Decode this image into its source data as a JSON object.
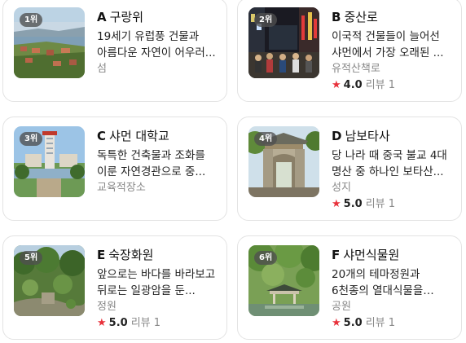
{
  "places": [
    {
      "rank": "1위",
      "letter": "A",
      "name": "구랑위",
      "desc": "19세기 유럽풍 건물과 아름다운 자연이 어우러...",
      "category": "섬"
    },
    {
      "rank": "2위",
      "letter": "B",
      "name": "중산로",
      "desc": "이국적 건물들이 늘어선 샤먼에서 가장 오래된 ...",
      "category": "유적산책로",
      "rating": "4.0",
      "reviews": "리뷰 1"
    },
    {
      "rank": "3위",
      "letter": "C",
      "name": "샤먼 대학교",
      "desc": "독특한 건축물과 조화를 이룬 자연경관으로 중...",
      "category": "교육적장소"
    },
    {
      "rank": "4위",
      "letter": "D",
      "name": "남보타사",
      "desc": "당 나라 때 중국 불교 4대 명산 중 하나인 보타산...",
      "category": "성지",
      "rating": "5.0",
      "reviews": "리뷰 1"
    },
    {
      "rank": "5위",
      "letter": "E",
      "name": "숙장화원",
      "desc": "앞으로는 바다를 바라보고 뒤로는 일광암을 둔...",
      "category": "정원",
      "rating": "5.0",
      "reviews": "리뷰 1"
    },
    {
      "rank": "6위",
      "letter": "F",
      "name": "샤먼식물원",
      "desc": "20개의 테마정원과 6천종의 열대식물을 보유한 ...",
      "category": "공원",
      "rating": "5.0",
      "reviews": "리뷰 1"
    }
  ],
  "icons": {
    "star": "★"
  },
  "colors": {
    "star": "#e8313b",
    "border": "#e3e3e3",
    "rank_badge": "#505050"
  }
}
